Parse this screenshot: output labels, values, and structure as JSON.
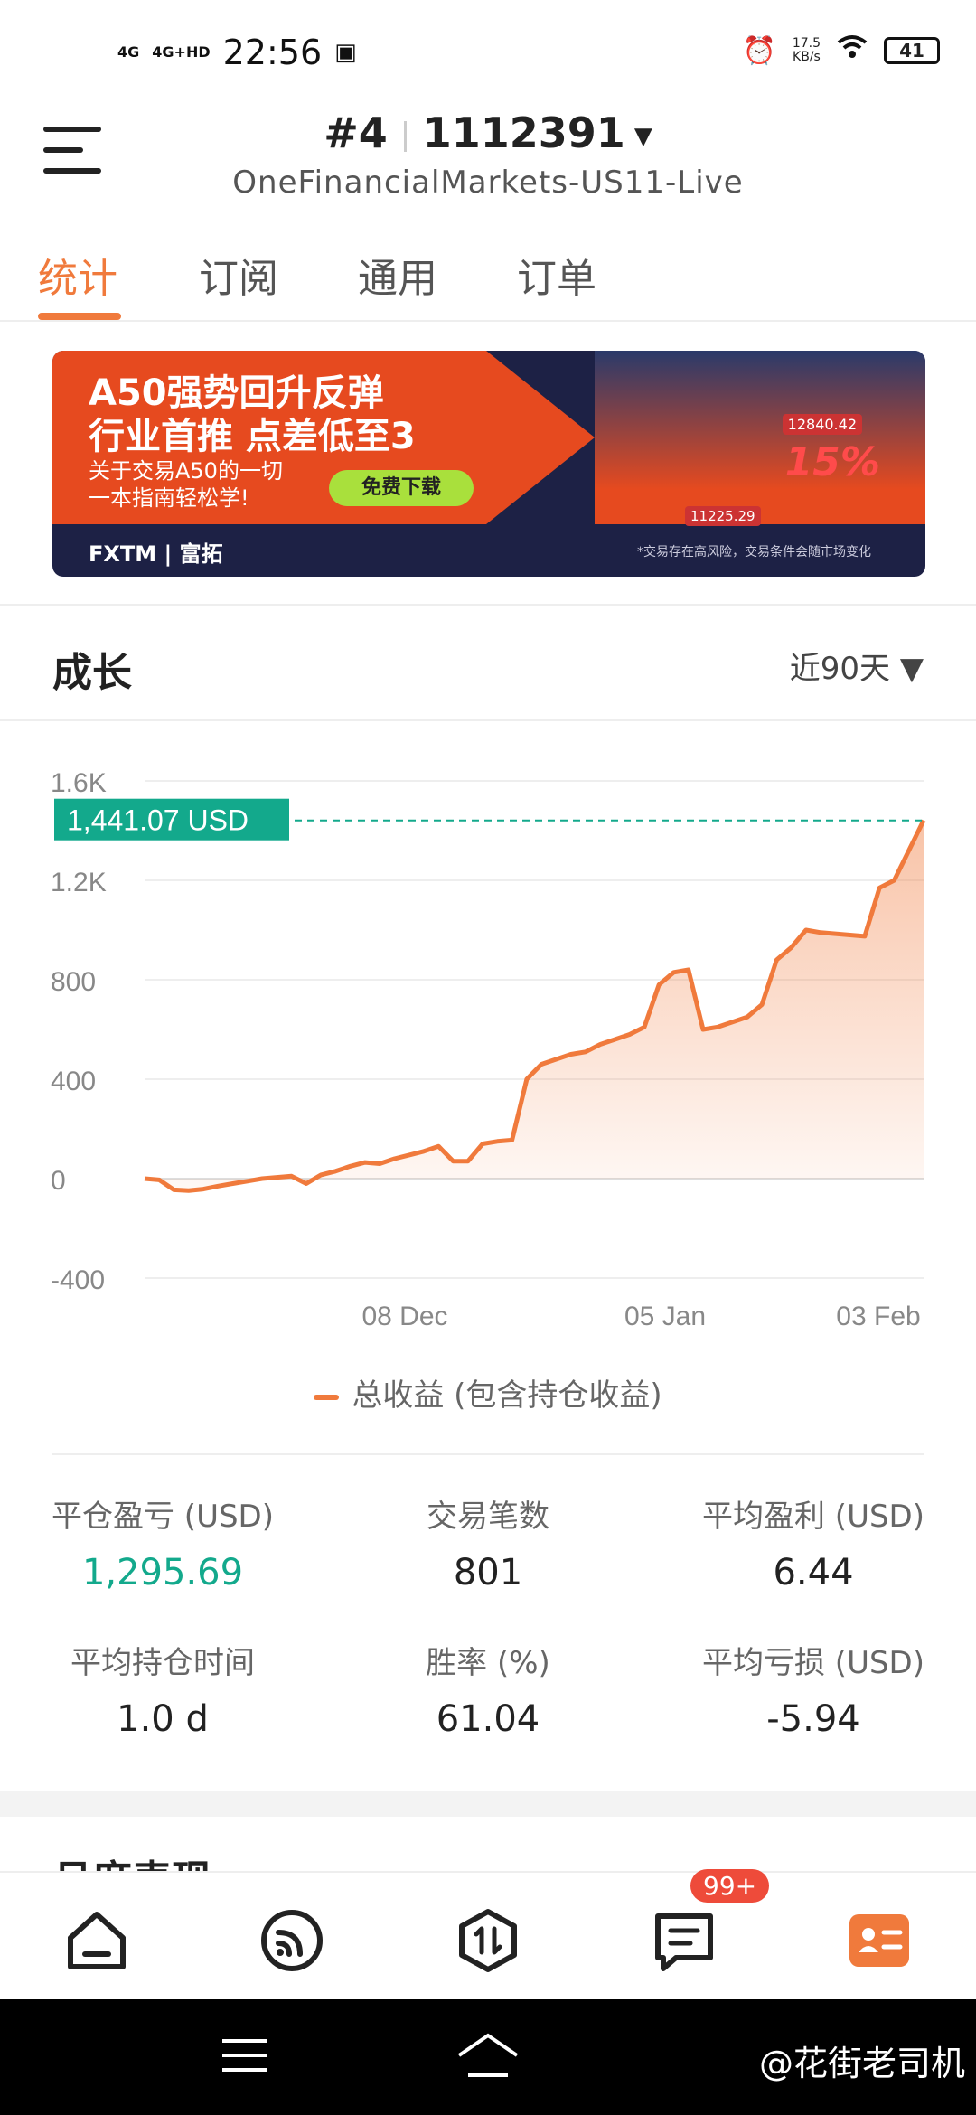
{
  "status": {
    "sig1": "4G",
    "sig2": "4G+HD",
    "time": "22:56",
    "speed_value": "17.5",
    "speed_unit": "KB/s",
    "battery": "41"
  },
  "header": {
    "account_index": "#4",
    "account_number": "1112391",
    "server": "OneFinancialMarkets-US11-Live"
  },
  "tabs": [
    {
      "label": "统计",
      "active": true
    },
    {
      "label": "订阅",
      "active": false
    },
    {
      "label": "通用",
      "active": false
    },
    {
      "label": "订单",
      "active": false
    }
  ],
  "banner": {
    "line1": "A50强势回升反弹",
    "line2": "行业首推 点差低至3",
    "line3": "关于交易A50的一切",
    "line4": "一本指南轻松学!",
    "button": "免费下载",
    "brand": "FXTM | 富拓",
    "disclaimer": "*交易存在高风险，交易条件会随市场变化",
    "price_high": "12840.42",
    "price_low": "11225.29",
    "percent": "15%"
  },
  "growth": {
    "title": "成长",
    "range": "近90天 ▼"
  },
  "chart_data": {
    "type": "area",
    "title": "",
    "ylim": [
      -400,
      1600
    ],
    "yticks": [
      "1.6K",
      "1.2K",
      "800",
      "400",
      "0",
      "-400"
    ],
    "ytick_values": [
      1600,
      1200,
      800,
      400,
      0,
      -400
    ],
    "xticks": [
      "08 Dec",
      "05 Jan",
      "03 Feb"
    ],
    "current_label": "1,441.07 USD",
    "current_value": 1441.07,
    "series": [
      {
        "name": "总收益 (包含持仓收益)",
        "values": [
          0,
          -5,
          -45,
          -48,
          -42,
          -30,
          -20,
          -10,
          0,
          5,
          10,
          -20,
          15,
          30,
          50,
          65,
          60,
          80,
          95,
          110,
          130,
          70,
          70,
          140,
          150,
          155,
          400,
          460,
          480,
          500,
          510,
          540,
          560,
          580,
          610,
          780,
          830,
          840,
          600,
          610,
          630,
          650,
          700,
          880,
          930,
          1000,
          990,
          985,
          980,
          975,
          1170,
          1200,
          1320,
          1441.07
        ],
        "color": "#f07a3c"
      }
    ]
  },
  "legend_label": "总收益 (包含持仓收益)",
  "stats": [
    {
      "label": "平仓盈亏 (USD)",
      "value": "1,295.69",
      "green": true
    },
    {
      "label": "交易笔数",
      "value": "801",
      "green": false
    },
    {
      "label": "平均盈利 (USD)",
      "value": "6.44",
      "green": false
    },
    {
      "label": "平均持仓时间",
      "value": "1.0 d",
      "green": false
    },
    {
      "label": "胜率 (%)",
      "value": "61.04",
      "green": false
    },
    {
      "label": "平均亏损 (USD)",
      "value": "-5.94",
      "green": false
    }
  ],
  "next_section": "月度表现",
  "nav": {
    "badge": "99+"
  },
  "watermark": "@花街老司机",
  "colors": {
    "accent": "#f07a3c",
    "green": "#13a98c",
    "badge": "#ee4b3a"
  }
}
